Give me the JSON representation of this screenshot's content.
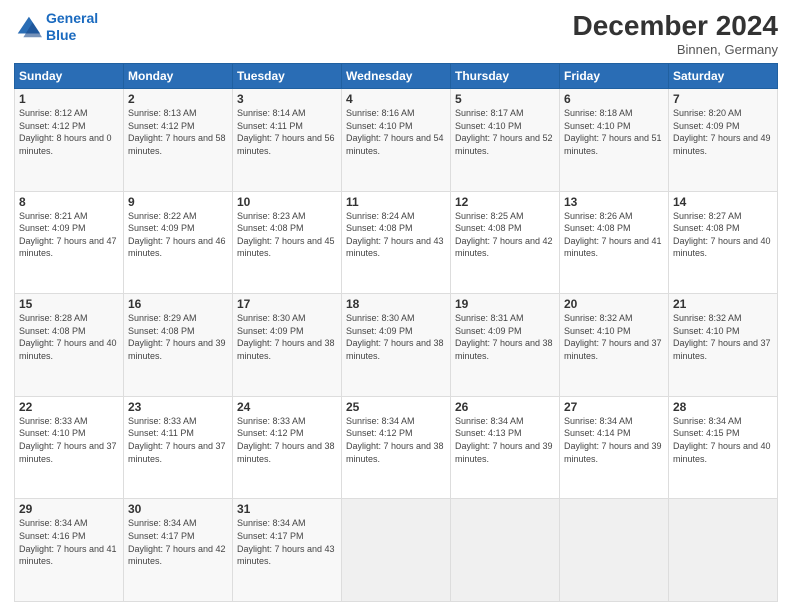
{
  "header": {
    "logo_line1": "General",
    "logo_line2": "Blue",
    "month": "December 2024",
    "location": "Binnen, Germany"
  },
  "days_of_week": [
    "Sunday",
    "Monday",
    "Tuesday",
    "Wednesday",
    "Thursday",
    "Friday",
    "Saturday"
  ],
  "weeks": [
    [
      {
        "day": "1",
        "sunrise": "Sunrise: 8:12 AM",
        "sunset": "Sunset: 4:12 PM",
        "daylight": "Daylight: 8 hours and 0 minutes."
      },
      {
        "day": "2",
        "sunrise": "Sunrise: 8:13 AM",
        "sunset": "Sunset: 4:12 PM",
        "daylight": "Daylight: 7 hours and 58 minutes."
      },
      {
        "day": "3",
        "sunrise": "Sunrise: 8:14 AM",
        "sunset": "Sunset: 4:11 PM",
        "daylight": "Daylight: 7 hours and 56 minutes."
      },
      {
        "day": "4",
        "sunrise": "Sunrise: 8:16 AM",
        "sunset": "Sunset: 4:10 PM",
        "daylight": "Daylight: 7 hours and 54 minutes."
      },
      {
        "day": "5",
        "sunrise": "Sunrise: 8:17 AM",
        "sunset": "Sunset: 4:10 PM",
        "daylight": "Daylight: 7 hours and 52 minutes."
      },
      {
        "day": "6",
        "sunrise": "Sunrise: 8:18 AM",
        "sunset": "Sunset: 4:10 PM",
        "daylight": "Daylight: 7 hours and 51 minutes."
      },
      {
        "day": "7",
        "sunrise": "Sunrise: 8:20 AM",
        "sunset": "Sunset: 4:09 PM",
        "daylight": "Daylight: 7 hours and 49 minutes."
      }
    ],
    [
      {
        "day": "8",
        "sunrise": "Sunrise: 8:21 AM",
        "sunset": "Sunset: 4:09 PM",
        "daylight": "Daylight: 7 hours and 47 minutes."
      },
      {
        "day": "9",
        "sunrise": "Sunrise: 8:22 AM",
        "sunset": "Sunset: 4:09 PM",
        "daylight": "Daylight: 7 hours and 46 minutes."
      },
      {
        "day": "10",
        "sunrise": "Sunrise: 8:23 AM",
        "sunset": "Sunset: 4:08 PM",
        "daylight": "Daylight: 7 hours and 45 minutes."
      },
      {
        "day": "11",
        "sunrise": "Sunrise: 8:24 AM",
        "sunset": "Sunset: 4:08 PM",
        "daylight": "Daylight: 7 hours and 43 minutes."
      },
      {
        "day": "12",
        "sunrise": "Sunrise: 8:25 AM",
        "sunset": "Sunset: 4:08 PM",
        "daylight": "Daylight: 7 hours and 42 minutes."
      },
      {
        "day": "13",
        "sunrise": "Sunrise: 8:26 AM",
        "sunset": "Sunset: 4:08 PM",
        "daylight": "Daylight: 7 hours and 41 minutes."
      },
      {
        "day": "14",
        "sunrise": "Sunrise: 8:27 AM",
        "sunset": "Sunset: 4:08 PM",
        "daylight": "Daylight: 7 hours and 40 minutes."
      }
    ],
    [
      {
        "day": "15",
        "sunrise": "Sunrise: 8:28 AM",
        "sunset": "Sunset: 4:08 PM",
        "daylight": "Daylight: 7 hours and 40 minutes."
      },
      {
        "day": "16",
        "sunrise": "Sunrise: 8:29 AM",
        "sunset": "Sunset: 4:08 PM",
        "daylight": "Daylight: 7 hours and 39 minutes."
      },
      {
        "day": "17",
        "sunrise": "Sunrise: 8:30 AM",
        "sunset": "Sunset: 4:09 PM",
        "daylight": "Daylight: 7 hours and 38 minutes."
      },
      {
        "day": "18",
        "sunrise": "Sunrise: 8:30 AM",
        "sunset": "Sunset: 4:09 PM",
        "daylight": "Daylight: 7 hours and 38 minutes."
      },
      {
        "day": "19",
        "sunrise": "Sunrise: 8:31 AM",
        "sunset": "Sunset: 4:09 PM",
        "daylight": "Daylight: 7 hours and 38 minutes."
      },
      {
        "day": "20",
        "sunrise": "Sunrise: 8:32 AM",
        "sunset": "Sunset: 4:10 PM",
        "daylight": "Daylight: 7 hours and 37 minutes."
      },
      {
        "day": "21",
        "sunrise": "Sunrise: 8:32 AM",
        "sunset": "Sunset: 4:10 PM",
        "daylight": "Daylight: 7 hours and 37 minutes."
      }
    ],
    [
      {
        "day": "22",
        "sunrise": "Sunrise: 8:33 AM",
        "sunset": "Sunset: 4:10 PM",
        "daylight": "Daylight: 7 hours and 37 minutes."
      },
      {
        "day": "23",
        "sunrise": "Sunrise: 8:33 AM",
        "sunset": "Sunset: 4:11 PM",
        "daylight": "Daylight: 7 hours and 37 minutes."
      },
      {
        "day": "24",
        "sunrise": "Sunrise: 8:33 AM",
        "sunset": "Sunset: 4:12 PM",
        "daylight": "Daylight: 7 hours and 38 minutes."
      },
      {
        "day": "25",
        "sunrise": "Sunrise: 8:34 AM",
        "sunset": "Sunset: 4:12 PM",
        "daylight": "Daylight: 7 hours and 38 minutes."
      },
      {
        "day": "26",
        "sunrise": "Sunrise: 8:34 AM",
        "sunset": "Sunset: 4:13 PM",
        "daylight": "Daylight: 7 hours and 39 minutes."
      },
      {
        "day": "27",
        "sunrise": "Sunrise: 8:34 AM",
        "sunset": "Sunset: 4:14 PM",
        "daylight": "Daylight: 7 hours and 39 minutes."
      },
      {
        "day": "28",
        "sunrise": "Sunrise: 8:34 AM",
        "sunset": "Sunset: 4:15 PM",
        "daylight": "Daylight: 7 hours and 40 minutes."
      }
    ],
    [
      {
        "day": "29",
        "sunrise": "Sunrise: 8:34 AM",
        "sunset": "Sunset: 4:16 PM",
        "daylight": "Daylight: 7 hours and 41 minutes."
      },
      {
        "day": "30",
        "sunrise": "Sunrise: 8:34 AM",
        "sunset": "Sunset: 4:17 PM",
        "daylight": "Daylight: 7 hours and 42 minutes."
      },
      {
        "day": "31",
        "sunrise": "Sunrise: 8:34 AM",
        "sunset": "Sunset: 4:17 PM",
        "daylight": "Daylight: 7 hours and 43 minutes."
      },
      null,
      null,
      null,
      null
    ]
  ]
}
